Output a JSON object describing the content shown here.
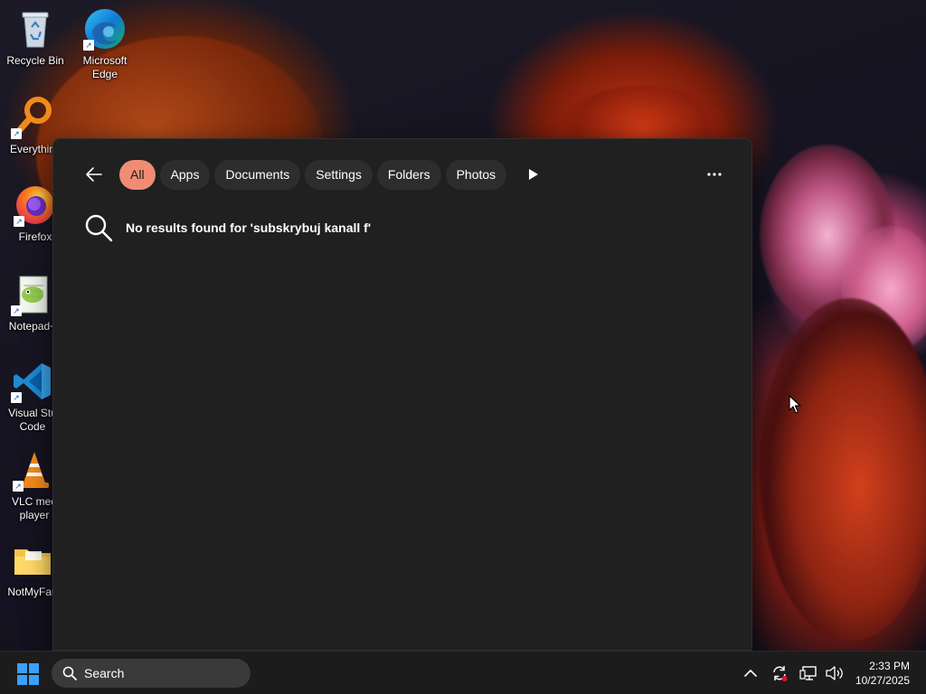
{
  "desktop": {
    "icons": [
      {
        "label": "Recycle Bin",
        "icon": "recycle-bin-icon"
      },
      {
        "label": "Microsoft Edge",
        "icon": "edge-icon"
      },
      {
        "label": "Everythin",
        "icon": "everything-search-icon"
      },
      {
        "label": "Firefox",
        "icon": "firefox-icon"
      },
      {
        "label": "Notepad+",
        "icon": "notepad-plus-plus-icon"
      },
      {
        "label": "Visual Stu Code",
        "icon": "vscode-icon"
      },
      {
        "label": "VLC med player",
        "icon": "vlc-icon"
      },
      {
        "label": "NotMyFau",
        "icon": "folder-icon"
      }
    ]
  },
  "search_flyout": {
    "back_icon": "arrow-left-icon",
    "filters": [
      "All",
      "Apps",
      "Documents",
      "Settings",
      "Folders",
      "Photos"
    ],
    "active_filter": "All",
    "more_filters_icon": "play-icon",
    "more_options_icon": "ellipsis-icon",
    "no_results_text": "No results found for 'subskrybuj kanall f'",
    "accent_color": "#f08c74",
    "background_color": "#202020"
  },
  "taskbar": {
    "start_icon": "windows-logo-icon",
    "search_placeholder": "Search",
    "tray_icons": [
      "chevron-up-icon",
      "sync-icon",
      "network-icon",
      "volume-icon"
    ],
    "time": "2:33 PM",
    "date": "10/27/2025",
    "background_color": "#1c1c1c"
  }
}
